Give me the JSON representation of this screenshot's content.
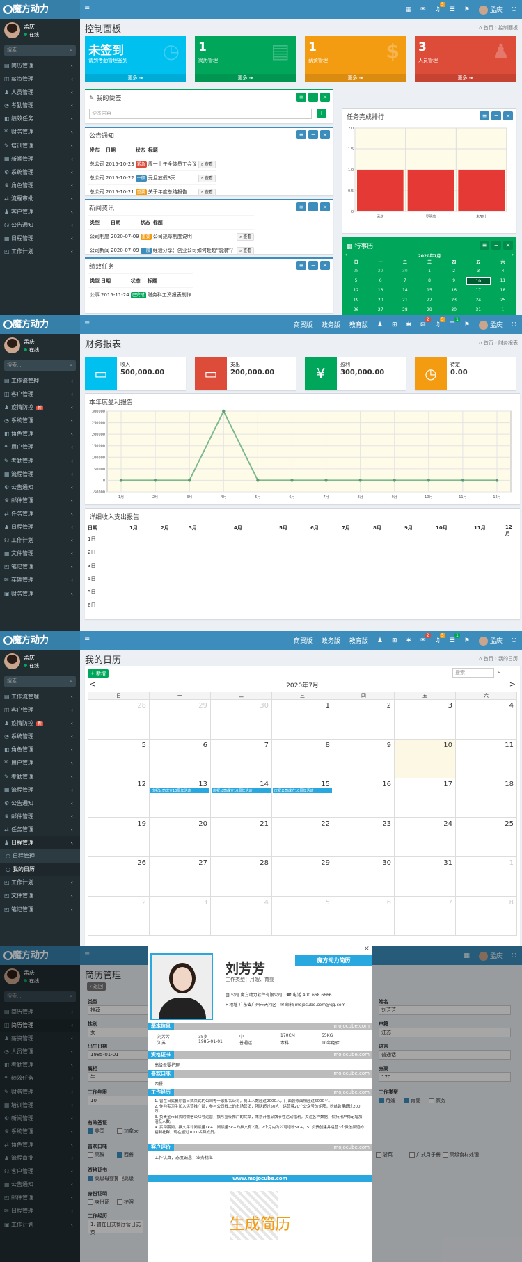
{
  "brand": "魔方动力",
  "user": {
    "name": "孟庆",
    "status": "在线",
    "search": "搜索..."
  },
  "top": {
    "nav": [
      "商贸版",
      "政务版",
      "教育版"
    ],
    "badges": [
      "2",
      "1",
      "5",
      "9"
    ]
  },
  "p1": {
    "title": "控制面板",
    "bc": [
      "首页",
      "控制面板"
    ],
    "menu": [
      "简历管理",
      "薪资管理",
      "人员管理",
      "考勤管理",
      "绩效任务",
      "财务管理",
      "培训管理",
      "新闻管理",
      "系统管理",
      "角色管理",
      "流程审批",
      "客户管理",
      "公告通知",
      "日程管理",
      "工作计划"
    ],
    "stats": [
      {
        "num": "未签到",
        "label": "请到考勤管理签到",
        "more": "更多",
        "color": "#00c0ef"
      },
      {
        "num": "1",
        "label": "简历管理",
        "more": "更多",
        "color": "#00a65a"
      },
      {
        "num": "1",
        "label": "薪资管理",
        "more": "更多",
        "color": "#f39c12"
      },
      {
        "num": "3",
        "label": "人员管理",
        "more": "更多",
        "color": "#dd4b39"
      }
    ],
    "memo": {
      "title": "我的便签",
      "placeholder": "便签内容"
    },
    "notice": {
      "title": "公告通知",
      "head": [
        "发布",
        "日期",
        "状态",
        "标题"
      ],
      "rows": [
        {
          "pub": "总公司",
          "date": "2015-10-23",
          "state": "紧急",
          "color": "#dd4b39",
          "title": "周一上午全体员工会议",
          "btn": "查看"
        },
        {
          "pub": "总公司",
          "date": "2015-10-22",
          "state": "一般",
          "color": "#3c8dbc",
          "title": "元旦放假3天",
          "btn": "查看"
        },
        {
          "pub": "总公司",
          "date": "2015-10-21",
          "state": "重要",
          "color": "#f39c12",
          "title": "关于年度总结报告",
          "btn": "查看"
        }
      ]
    },
    "news": {
      "title": "新闻资讯",
      "head": [
        "类型",
        "日期",
        "状态",
        "标题"
      ],
      "rows": [
        {
          "pub": "公司制度",
          "date": "2020-07-09",
          "state": "重要",
          "color": "#f39c12",
          "title": "公司规章制度说明",
          "btn": "查看"
        },
        {
          "pub": "公司新闻",
          "date": "2020-07-09",
          "state": "一般",
          "color": "#3c8dbc",
          "title": "经验分享：创业公司如何赶超\"前浪\"？",
          "btn": "查看"
        }
      ]
    },
    "perf": {
      "title": "绩效任务",
      "head": [
        "类型",
        "日期",
        "状态",
        "标题"
      ],
      "rows": [
        {
          "pub": "公事",
          "date": "2015-11-24",
          "state": "已完成",
          "color": "#00a65a",
          "title": "财务科工资报表制作"
        }
      ]
    },
    "rank": {
      "title": "任务完成排行",
      "yticks": [
        "2.0",
        "1.5",
        "1.0",
        "0.5",
        "0"
      ]
    },
    "sched": {
      "title": "行事历",
      "month": "2020年7月",
      "week": [
        "日",
        "一",
        "二",
        "三",
        "四",
        "五",
        "六"
      ],
      "days": [
        "28",
        "29",
        "30",
        "1",
        "2",
        "3",
        "4",
        "5",
        "6",
        "7",
        "8",
        "9",
        "10",
        "11",
        "12",
        "13",
        "14",
        "15",
        "16",
        "17",
        "18",
        "19",
        "20",
        "21",
        "22",
        "23",
        "24",
        "25",
        "26",
        "27",
        "28",
        "29",
        "30",
        "31",
        "1"
      ]
    }
  },
  "chart_data": {
    "type": "bar",
    "categories": [
      "孟庆",
      "罗明欣",
      "朱丽叶"
    ],
    "values": [
      1,
      1,
      1
    ],
    "ylim": [
      0,
      2
    ]
  },
  "p2": {
    "title": "财务报表",
    "bc": [
      "首页",
      "财务报表"
    ],
    "menu": [
      "工作流管理",
      "客户管理",
      "疫情防控",
      "系统管理",
      "角色管理",
      "用户管理",
      "考勤管理",
      "流程管理",
      "公告通知",
      "邮件管理",
      "任务管理",
      "日程管理",
      "工作计划",
      "文件管理",
      "笔记管理",
      "车辆管理",
      "财务管理"
    ],
    "tag": "新",
    "info": [
      {
        "label": "收入",
        "value": "500,000.00",
        "color": "#00c0ef",
        "icon": "▭"
      },
      {
        "label": "支出",
        "value": "200,000.00",
        "color": "#dd4b39",
        "icon": "▭"
      },
      {
        "label": "盈利",
        "value": "300,000.00",
        "color": "#00a65a",
        "icon": "¥"
      },
      {
        "label": "待定",
        "value": "0.00",
        "color": "#f39c12",
        "icon": "◷"
      }
    ],
    "profit": {
      "title": "本年度盈利报告",
      "months": [
        "1月",
        "2月",
        "3月",
        "4月",
        "5月",
        "6月",
        "7月",
        "8月",
        "9月",
        "10月",
        "11月",
        "12月"
      ],
      "yticks": [
        "300000",
        "250000",
        "200000",
        "150000",
        "100000",
        "50000",
        "0",
        "-50000"
      ],
      "values": [
        0,
        0,
        0,
        300000,
        0,
        0,
        0,
        0,
        0,
        0,
        0,
        0
      ]
    },
    "detail": {
      "title": "详细收入支出报告",
      "head": [
        "日期",
        "1月",
        "2月",
        "3月",
        "4月",
        "5月",
        "6月",
        "7月",
        "8月",
        "9月",
        "10月",
        "11月",
        "12月"
      ],
      "days": [
        "1日",
        "2日",
        "3日",
        "4日",
        "5日",
        "6日"
      ]
    }
  },
  "p3": {
    "title": "我的日历",
    "bc": [
      "首页",
      "我的日历"
    ],
    "add": "新增",
    "search": "搜索",
    "menu": [
      "工作流管理",
      "客户管理",
      "疫情防控",
      "系统管理",
      "角色管理",
      "用户管理",
      "考勤管理",
      "流程管理",
      "公告通知",
      "邮件管理",
      "任务管理",
      "日程管理"
    ],
    "submenu": [
      "日程管理",
      "我的日历"
    ],
    "menu2": [
      "工作计划",
      "文件管理",
      "笔记管理"
    ],
    "month": "2020年7月",
    "week": [
      "日",
      "一",
      "二",
      "三",
      "四",
      "五",
      "六"
    ],
    "days": [
      "28",
      "29",
      "30",
      "1",
      "2",
      "3",
      "4",
      "5",
      "6",
      "7",
      "8",
      "9",
      "10",
      "11",
      "12",
      "13",
      "14",
      "15",
      "16",
      "17",
      "18",
      "19",
      "20",
      "21",
      "22",
      "23",
      "24",
      "25",
      "26",
      "27",
      "28",
      "29",
      "30",
      "31",
      "1",
      "2",
      "3",
      "4",
      "5",
      "6",
      "7",
      "8"
    ],
    "event": "庆祝公司成立10周年活动"
  },
  "p4": {
    "title": "简历管理",
    "back": "返回",
    "menu": [
      "简历管理",
      "简历管理",
      "薪资管理",
      "人员管理",
      "考勤管理",
      "绩效任务",
      "财务管理",
      "培训管理",
      "新闻管理",
      "系统管理",
      "角色管理",
      "流程审批",
      "客户管理",
      "公告通知",
      "邮件管理",
      "日程管理",
      "工作计划"
    ],
    "left": {
      "type": "类型",
      "type_v": "推荐",
      "sex": "性别",
      "sex_v": "女",
      "birth": "出生日期",
      "birth_v": "1985-01-01",
      "zodiac": "属相",
      "zodiac_v": "牛",
      "years": "工作年限",
      "years_v": "10",
      "welfare": "有效签证",
      "w1": "美国",
      "w2": "加拿大",
      "taste": "喜欢口味",
      "t1": "高鲜",
      "t2": "西餐",
      "cert": "资格证书",
      "c1": "高级母婴护理",
      "c2": "高级",
      "id": "身份证明",
      "i1": "身份证",
      "i2": "护照",
      "exp": "工作经历",
      "exp_v": "1. 曾在日式餐厅营日式菜"
    },
    "right": {
      "name": "姓名",
      "name_v": "刘芳芳",
      "reg": "户籍",
      "reg_v": "江苏",
      "lang": "语言",
      "lang_v": "普通话",
      "height": "身高",
      "height_v": "170",
      "jt": "工作类型",
      "j1": "月嫂",
      "j2": "育婴",
      "j3": "家务",
      "cook": "浙菜",
      "cook2": "广式月子餐",
      "cook3": "高级食材处理"
    },
    "resume": {
      "name": "刘芳芳",
      "jobtype": "工作类型：月嫂、育婴",
      "brand": "魔方动力简历",
      "company_k": "公司",
      "company": "魔方动力软件有限公司",
      "phone_k": "电话",
      "phone": "400 668 6666",
      "addr_k": "地址",
      "addr": "广东省广州市天河区",
      "mail_k": "邮箱",
      "mail": "mojocube.com@qq.com",
      "wm": "mojocube.com",
      "s1": "基本信息",
      "basic": [
        [
          "刘芳芳",
          "35岁",
          "中",
          "170CM",
          "55KG"
        ],
        [
          "江苏",
          "1985-01-01",
          "普通话",
          "本科",
          "10年经验"
        ]
      ],
      "s2": "资格证书",
      "cert": "高级母婴护理",
      "s3": "喜欢口味",
      "taste": "西餐",
      "s4": "工作经历",
      "exp": [
        "1. 曾在日式餐厅营日式菜式的公司等一家知名公司，员工人数超过2000人，门面装修面积超过5000平。",
        "2. 作为实习生加入运营推广部，参与公司线上的市场营销，团队超过50人，运营着20个公众号的矩阵，粉丝数量超过200万。",
        "3. 负责金币日式的微信公众号运营，撰写宣传推广的文章，策划开展品牌节性活动福利，关注各种数据，保持用户稳定增加活跃人数。",
        "4. 实习期间，推文平均阅读量1k+，阅读量5k+的推文有2篇，2个月内为公司增粉5K+，5. 负责创建并运营3个微信渠道的福利社群，现在超过1000名群成员。"
      ],
      "s5": "客户评价",
      "eval": "工作认真，态度诚恳，业务精湛！",
      "url": "www.mojocube.com",
      "gen": "生成简历"
    }
  }
}
